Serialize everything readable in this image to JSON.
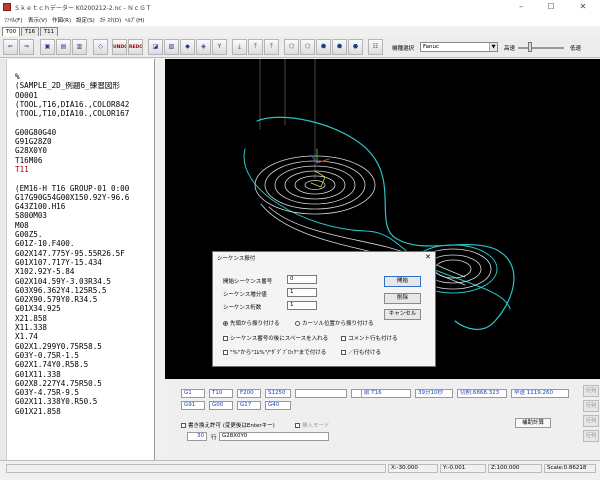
{
  "window": {
    "title": "Ｓｋｅｔｃｈデーター K0200212-2.nc - ＮｃＧＴ",
    "minimize_glyph": "–",
    "maximize_glyph": "☐",
    "close_glyph": "✕"
  },
  "menu": [
    "ﾌｧｲﾙ(F)",
    "表示(V)",
    "作図(R)",
    "設定(S)",
    "ｶﾃ ｽｸ(D)",
    "ﾍﾙﾌﾟ(H)"
  ],
  "tabs": [
    "T00",
    "T16",
    "T11"
  ],
  "toolbar": {
    "glyphs": [
      "⇐",
      "⇒",
      "▣",
      "▤",
      "▥",
      "◇",
      "UNDO",
      "REDO",
      "◪",
      "▨",
      "◆",
      "◈",
      "Y",
      "⤓",
      "⤒",
      "⤒",
      "⬡",
      "⬡",
      "⬢",
      "⬢",
      "⬣",
      "Ⅲ",
      "☷"
    ],
    "model_label": "機種選択",
    "model_value": "Fanuc",
    "speed_high": "高速",
    "speed_low": "低速",
    "speed_level": 0.25
  },
  "editor": {
    "lines": [
      {
        "text": "%"
      },
      {
        "text": "(SAMPLE_2D_例題6_練習図形"
      },
      {
        "text": "O0001"
      },
      {
        "text": "(TOOL,T16,DIA16.,COLOR842"
      },
      {
        "text": "(TOOL,T10,DIA10.,COLOR167"
      },
      {
        "text": ""
      },
      {
        "text": "G00G80G40"
      },
      {
        "text": "G91G28Z0"
      },
      {
        "text": "G28X0Y0"
      },
      {
        "text": "T16M06"
      },
      {
        "text": "T11",
        "color": "#c00000"
      },
      {
        "text": ""
      },
      {
        "text": "(EM16-H T16 GROUP-01 0:00"
      },
      {
        "text": "G17G90G54G00X150.92Y-96.6"
      },
      {
        "text": "G43Z100.H16"
      },
      {
        "text": "S800M03"
      },
      {
        "text": "M08"
      },
      {
        "text": "G00Z5."
      },
      {
        "text": "G01Z-10.F400."
      },
      {
        "text": "G02X147.775Y-95.55R26.5F"
      },
      {
        "text": "G01X107.717Y-15.434"
      },
      {
        "text": "X102.92Y-5.84"
      },
      {
        "text": "G02X104.59Y-3.03R34.5"
      },
      {
        "text": "G03X96.362Y4.125R5.5"
      },
      {
        "text": "G02X90.579Y0.R34.5"
      },
      {
        "text": "G01X34.925"
      },
      {
        "text": "X21.858"
      },
      {
        "text": "X11.338"
      },
      {
        "text": "X1.74"
      },
      {
        "text": "G02X1.299Y0.75R58.5"
      },
      {
        "text": "G03Y-0.75R-1.5"
      },
      {
        "text": "G02X1.74Y0.R58.5"
      },
      {
        "text": "G01X11.338"
      },
      {
        "text": "G02X8.227Y4.75R50.5"
      },
      {
        "text": "G03Y-4.75R-9.5"
      },
      {
        "text": "G02X11.338Y0.R50.5"
      },
      {
        "text": "G01X21.858"
      }
    ]
  },
  "dialog": {
    "title": "シーケンス振付",
    "close_glyph": "✕",
    "start_label": "開始シーケンス番号",
    "start_value": "0",
    "step_label": "シーケンス増分値",
    "step_value": "1",
    "digits_label": "シーケンス桁数",
    "digits_value": "1",
    "ok_label": "開始",
    "delete_label": "削除",
    "cancel_label": "キャンセル",
    "radio_from_top": "先頭から振り付ける",
    "radio_from_cursor": "カーソル位置から振り付ける",
    "chk_space": "シーケンス番号の後にスペースを入れる",
    "chk_comment": "コメント行も付ける",
    "chk_percent": "\"%\"から\"ｴﾑ%\"/\"ﾀﾞｸﾞﾌﾞﾛｯｸ\"まで付ける",
    "chk_slash": "／行も付ける"
  },
  "panel": {
    "codes_row1": [
      "G1",
      "T10",
      "F200",
      "S1250"
    ],
    "codes_row2": [
      "G91",
      "G00",
      "G17",
      "G40"
    ],
    "counter": "前 T16",
    "time": "39分10秒",
    "cut_time": "切削:6868.323",
    "fast_time": "早送 1119.260",
    "checkbox_rewrite": "書き換え許可 (変更後はEnterキー)",
    "checkbox_insert": "挿入モード",
    "calc_button": "補助計算",
    "line_number": "30",
    "line_label": "行",
    "line_text": "G28X0Y0",
    "side_buttons": [
      "行列",
      "行列",
      "行列",
      "行列"
    ]
  },
  "status": {
    "x": "X:-30.000",
    "y": "Y:-0.001",
    "z": "Z:100.000",
    "scale": "Scale:0.86218"
  }
}
